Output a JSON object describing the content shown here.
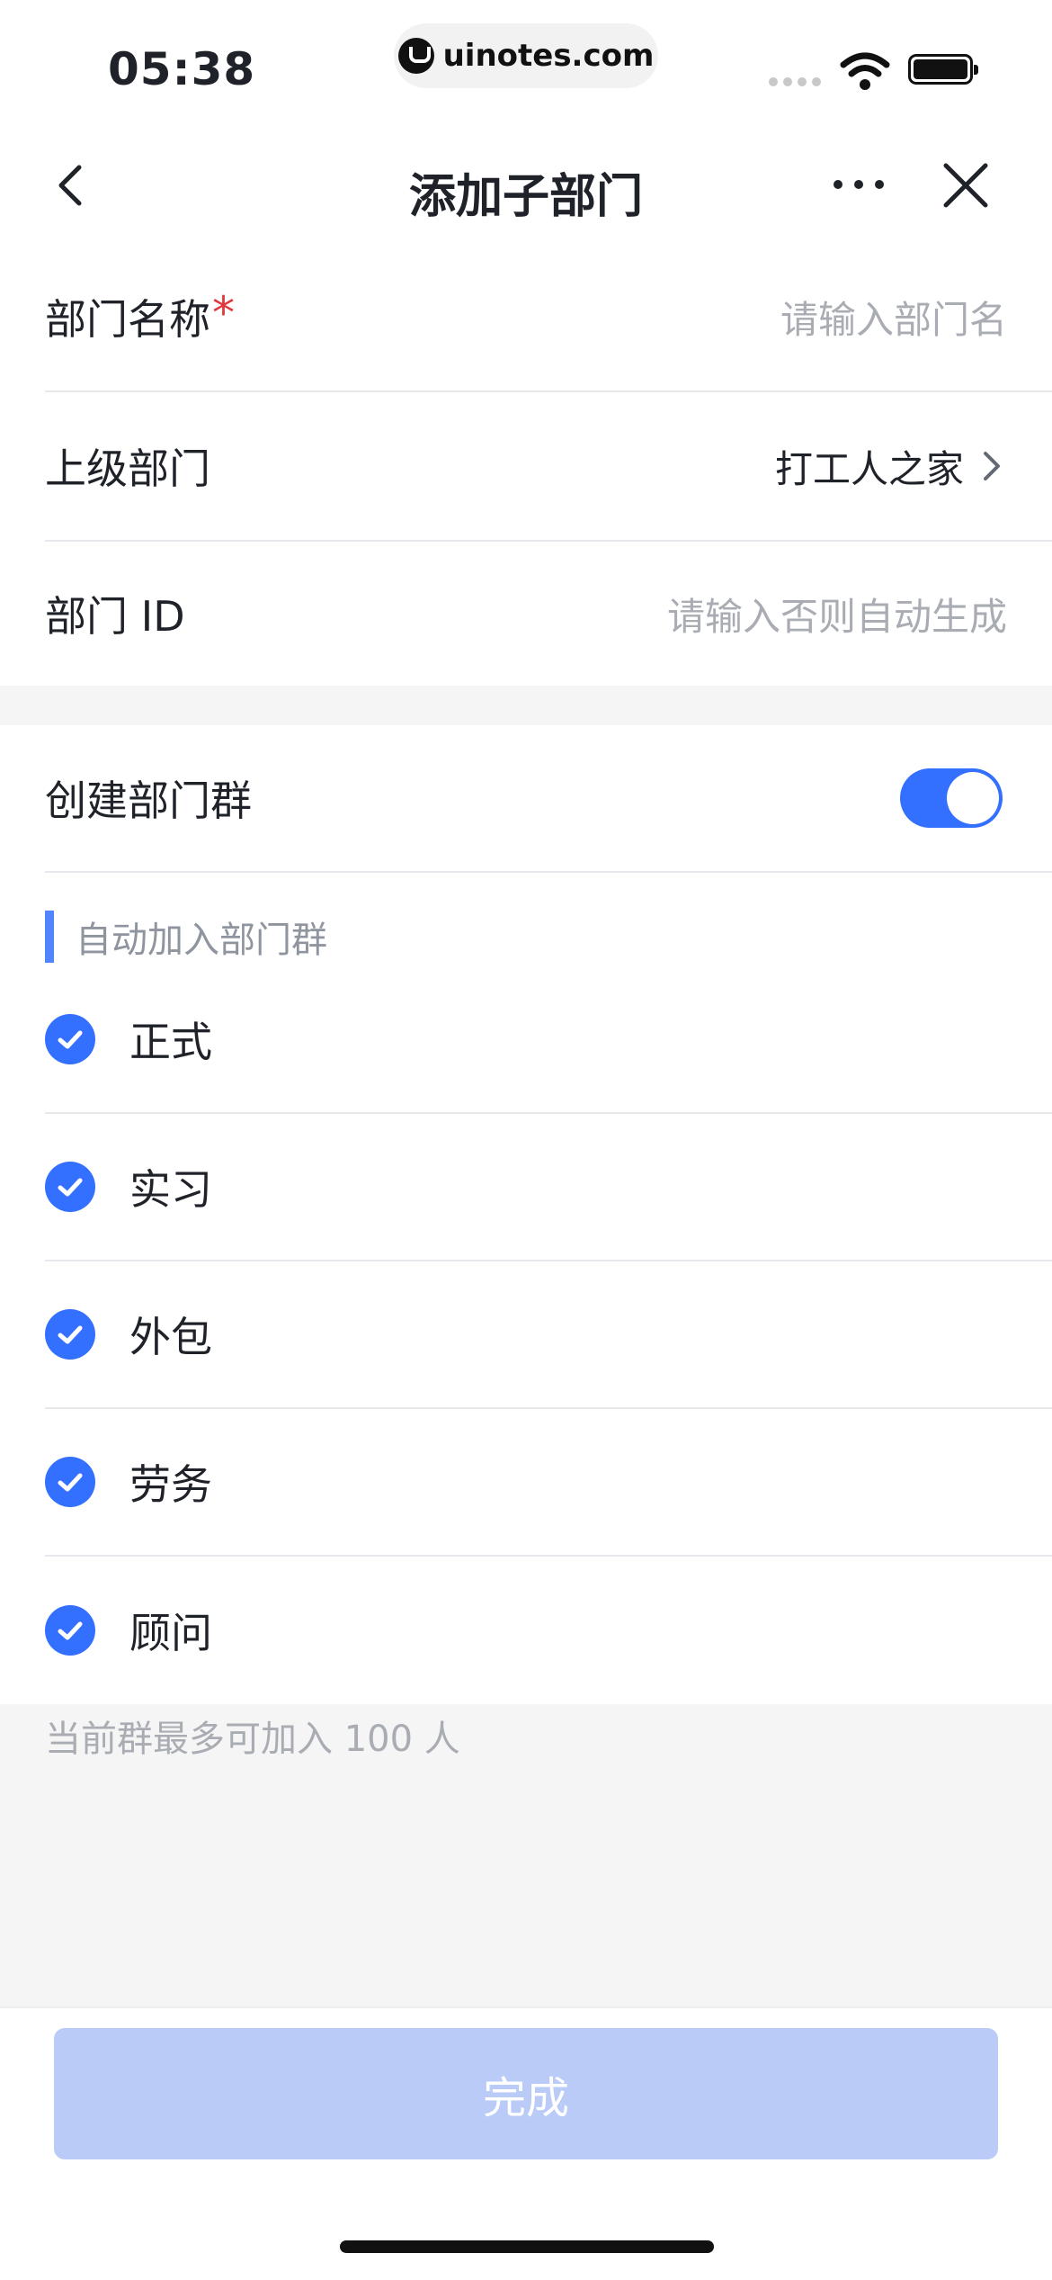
{
  "status_bar": {
    "time": "05:38",
    "url": "uinotes.com"
  },
  "nav": {
    "title": "添加子部门",
    "icons": [
      "back-icon",
      "more-icon",
      "close-icon"
    ]
  },
  "form": {
    "dept_name": {
      "label": "部门名称",
      "required_mark": "*",
      "placeholder": "请输入部门名"
    },
    "parent_dept": {
      "label": "上级部门",
      "value": "打工人之家"
    },
    "dept_id": {
      "label": "部门 ID",
      "placeholder": "请输入否则自动生成"
    }
  },
  "group": {
    "label": "创建部门群",
    "toggle_on": true,
    "section_title": "自动加入部门群",
    "options": [
      {
        "label": "正式",
        "checked": true
      },
      {
        "label": "实习",
        "checked": true
      },
      {
        "label": "外包",
        "checked": true
      },
      {
        "label": "劳务",
        "checked": true
      },
      {
        "label": "顾问",
        "checked": true
      }
    ],
    "hint": "当前群最多可加入 100 人"
  },
  "footer": {
    "done_label": "完成"
  },
  "colors": {
    "accent": "#3370ff",
    "required": "#e0383e",
    "button_disabled": "#bacbf7",
    "placeholder": "#a9adb3"
  }
}
